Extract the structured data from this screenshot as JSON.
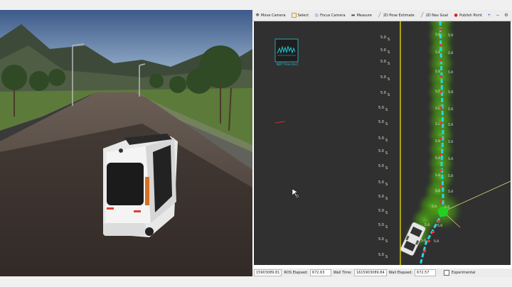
{
  "toolbar": {
    "move_camera": "Move Camera",
    "select": "Select",
    "focus_camera": "Focus Camera",
    "measure": "Measure",
    "pose_estimate": "2D Pose Estimate",
    "nav_goal": "2D Nav Goal",
    "publish_point": "Publish Point",
    "icons": [
      "move-camera-icon",
      "select-icon",
      "focus-camera-icon",
      "measure-icon",
      "pose-estimate-icon",
      "nav-goal-icon",
      "publish-point-icon",
      "add-tool-icon",
      "remove-tool-icon",
      "settings-icon"
    ]
  },
  "viz": {
    "overlay_caption": "NDT Time [ms]",
    "left_labels": [
      "5.0",
      "5.0",
      "5.0",
      "5.0",
      "5.0",
      "5.0",
      "5.0",
      "5.0",
      "5.0",
      "5.0",
      "5.0",
      "5.0",
      "5.0",
      "5.0",
      "5.0",
      "5.0"
    ],
    "right_labels": [
      "5.0",
      "5.0",
      "5.0",
      "5.0",
      "5.0",
      "5.0",
      "5.0",
      "5.0",
      "5.0",
      "5.0",
      "5.0",
      "5.0",
      "5.0"
    ],
    "unit_s": "S",
    "colors": {
      "background": "#303030",
      "path": "#2ad4e8",
      "corridor": "#5fc61a",
      "lane_line": "#e8e000",
      "marker": "#ff3030"
    }
  },
  "status": {
    "ros_time": "15903089.81",
    "ros_elapsed_label": "ROS Elapsed:",
    "ros_elapsed": "672.63",
    "wall_time_label": "Wall Time:",
    "wall_time": "1615903089.84",
    "wall_elapsed_label": "Wall Elapsed:",
    "wall_elapsed": "672.57",
    "experimental_label": "Experimental"
  }
}
